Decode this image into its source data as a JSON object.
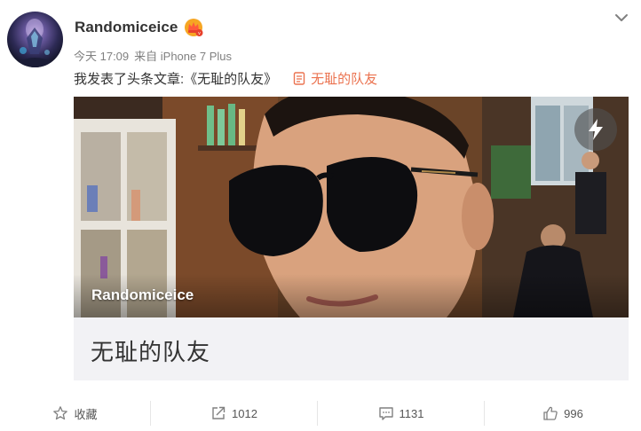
{
  "post": {
    "username": "Randomiceice",
    "time": "今天 17:09",
    "source": "来自 iPhone 7 Plus",
    "text": "我发表了头条文章:《无耻的队友》",
    "link_text": "无耻的队友"
  },
  "article": {
    "cover_author": "Randomiceice",
    "title": "无耻的队友"
  },
  "actions": {
    "favorite": "收藏",
    "repost": "1012",
    "comment": "1131",
    "like": "996"
  },
  "icons": {
    "vip": "vip-crown-icon",
    "menu": "chevron-down-icon",
    "doc": "document-icon",
    "flash": "lightning-icon",
    "favorite": "star-icon",
    "repost": "share-icon",
    "comment": "comment-icon",
    "like": "thumbs-up-icon"
  },
  "colors": {
    "accent": "#eb7350",
    "meta": "#808080",
    "card_bg": "#f2f2f5"
  }
}
